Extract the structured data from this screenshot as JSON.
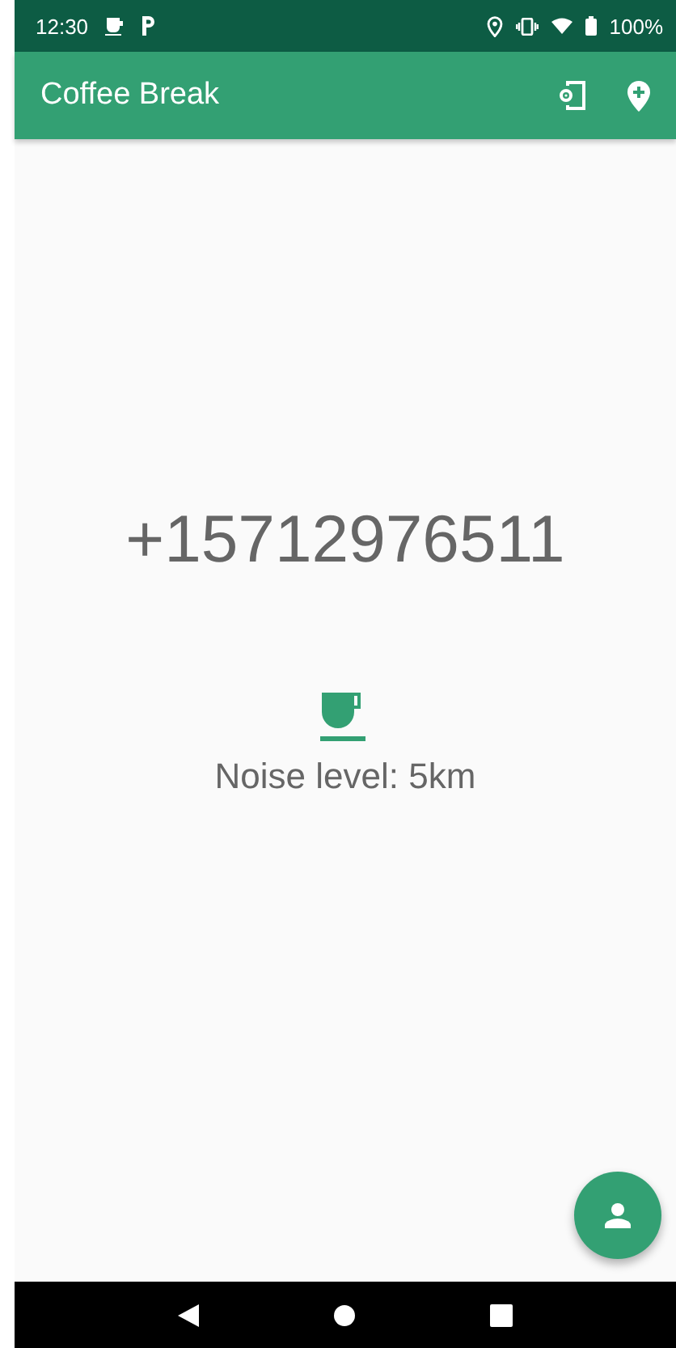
{
  "status_bar": {
    "time": "12:30",
    "battery": "100%"
  },
  "app_bar": {
    "title": "Coffee Break"
  },
  "content": {
    "phone": "+15712976511",
    "noise_label": "Noise level: 5km"
  }
}
